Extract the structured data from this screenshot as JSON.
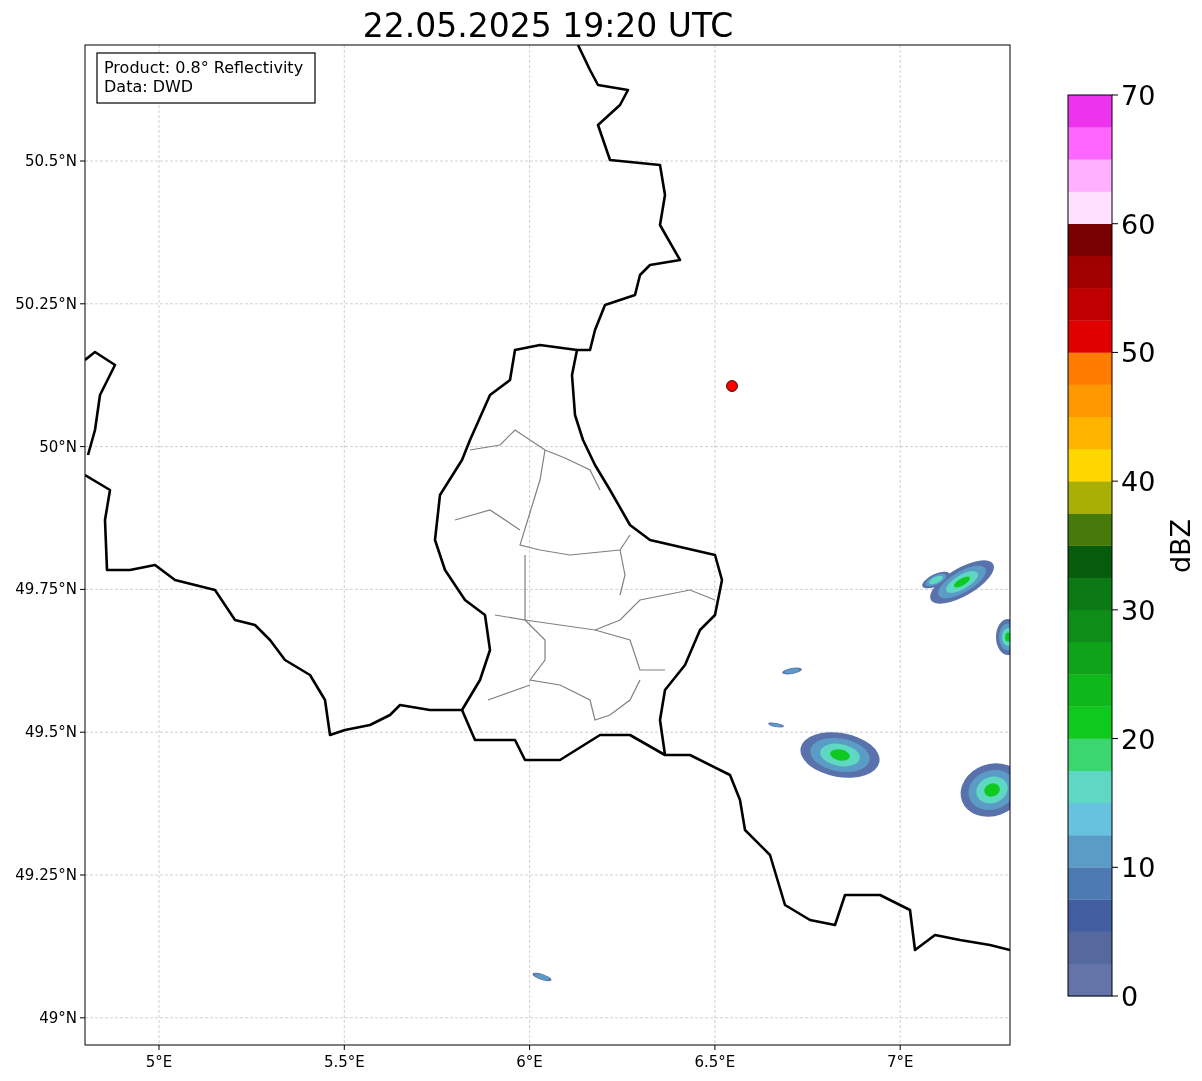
{
  "title": "22.05.2025 19:20 UTC",
  "annotation": {
    "lines": [
      "Product: 0.8° Reflectivity",
      "Data: DWD"
    ]
  },
  "map": {
    "xticks": [
      "5°E",
      "5.5°E",
      "6°E",
      "6.5°E",
      "7°E"
    ],
    "yticks": [
      "50.5°N",
      "50.25°N",
      "50°N",
      "49.75°N",
      "49.5°N",
      "49.25°N",
      "49°N"
    ]
  },
  "colorbar": {
    "label": "dBZ",
    "ticks": [
      "70",
      "60",
      "50",
      "40",
      "30",
      "20",
      "10",
      "0"
    ],
    "segments": [
      {
        "color": "#6474a8"
      },
      {
        "color": "#55699f"
      },
      {
        "color": "#435ea0"
      },
      {
        "color": "#4d7ab2"
      },
      {
        "color": "#5a9cc6"
      },
      {
        "color": "#66c2de"
      },
      {
        "color": "#5fd8c3"
      },
      {
        "color": "#3cd670"
      },
      {
        "color": "#10c91f"
      },
      {
        "color": "#0eb81a"
      },
      {
        "color": "#0ea318"
      },
      {
        "color": "#0e8e18"
      },
      {
        "color": "#0b7a14"
      },
      {
        "color": "#075c0b"
      },
      {
        "color": "#467a0a"
      },
      {
        "color": "#a8b006"
      },
      {
        "color": "#ffd700"
      },
      {
        "color": "#ffb400"
      },
      {
        "color": "#ff9800"
      },
      {
        "color": "#ff7c00"
      },
      {
        "color": "#e00000"
      },
      {
        "color": "#c00000"
      },
      {
        "color": "#a00000"
      },
      {
        "color": "#780000"
      },
      {
        "color": "#ffe0ff"
      },
      {
        "color": "#ffb0ff"
      },
      {
        "color": "#ff66ff"
      },
      {
        "color": "#ee33ee"
      }
    ]
  }
}
